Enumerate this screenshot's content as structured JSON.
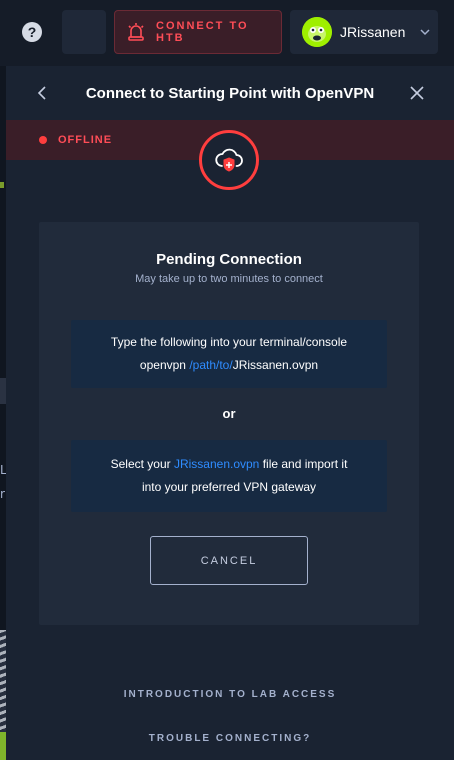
{
  "topbar": {
    "help_glyph": "?",
    "connect_label": "CONNECT TO HTB",
    "user_name": "JRissanen",
    "icons": {
      "help": "help-icon",
      "connect": "alarm-icon",
      "user_menu": "chevron-down-icon"
    }
  },
  "background": {
    "peek_text": "L\nr"
  },
  "panel": {
    "title": "Connect to Starting Point with OpenVPN",
    "status": "OFFLINE",
    "icon": "cloud-shield-icon",
    "card": {
      "title": "Pending Connection",
      "subtitle": "May take up to two minutes to connect",
      "terminal_instruction": "Type the following into your terminal/console",
      "command_prefix": "openvpn ",
      "command_path": "/path/to/",
      "command_file": "JRissanen.ovpn",
      "or_text": "or",
      "select_prefix": "Select your ",
      "select_file": "JRissanen.ovpn",
      "select_suffix": " file and import it",
      "select_line2": "into your preferred VPN gateway",
      "cancel_label": "CANCEL"
    },
    "links": {
      "intro": "INTRODUCTION TO LAB ACCESS",
      "trouble": "TROUBLE CONNECTING?"
    }
  },
  "colors": {
    "background": "#151c28",
    "panel": "#1a2332",
    "card": "#212b3b",
    "info_box": "#172a42",
    "danger": "#ff3e3e",
    "accent_blue": "#2f8cff",
    "muted_text": "#a4b1cd",
    "avatar_green": "#9fef00"
  }
}
